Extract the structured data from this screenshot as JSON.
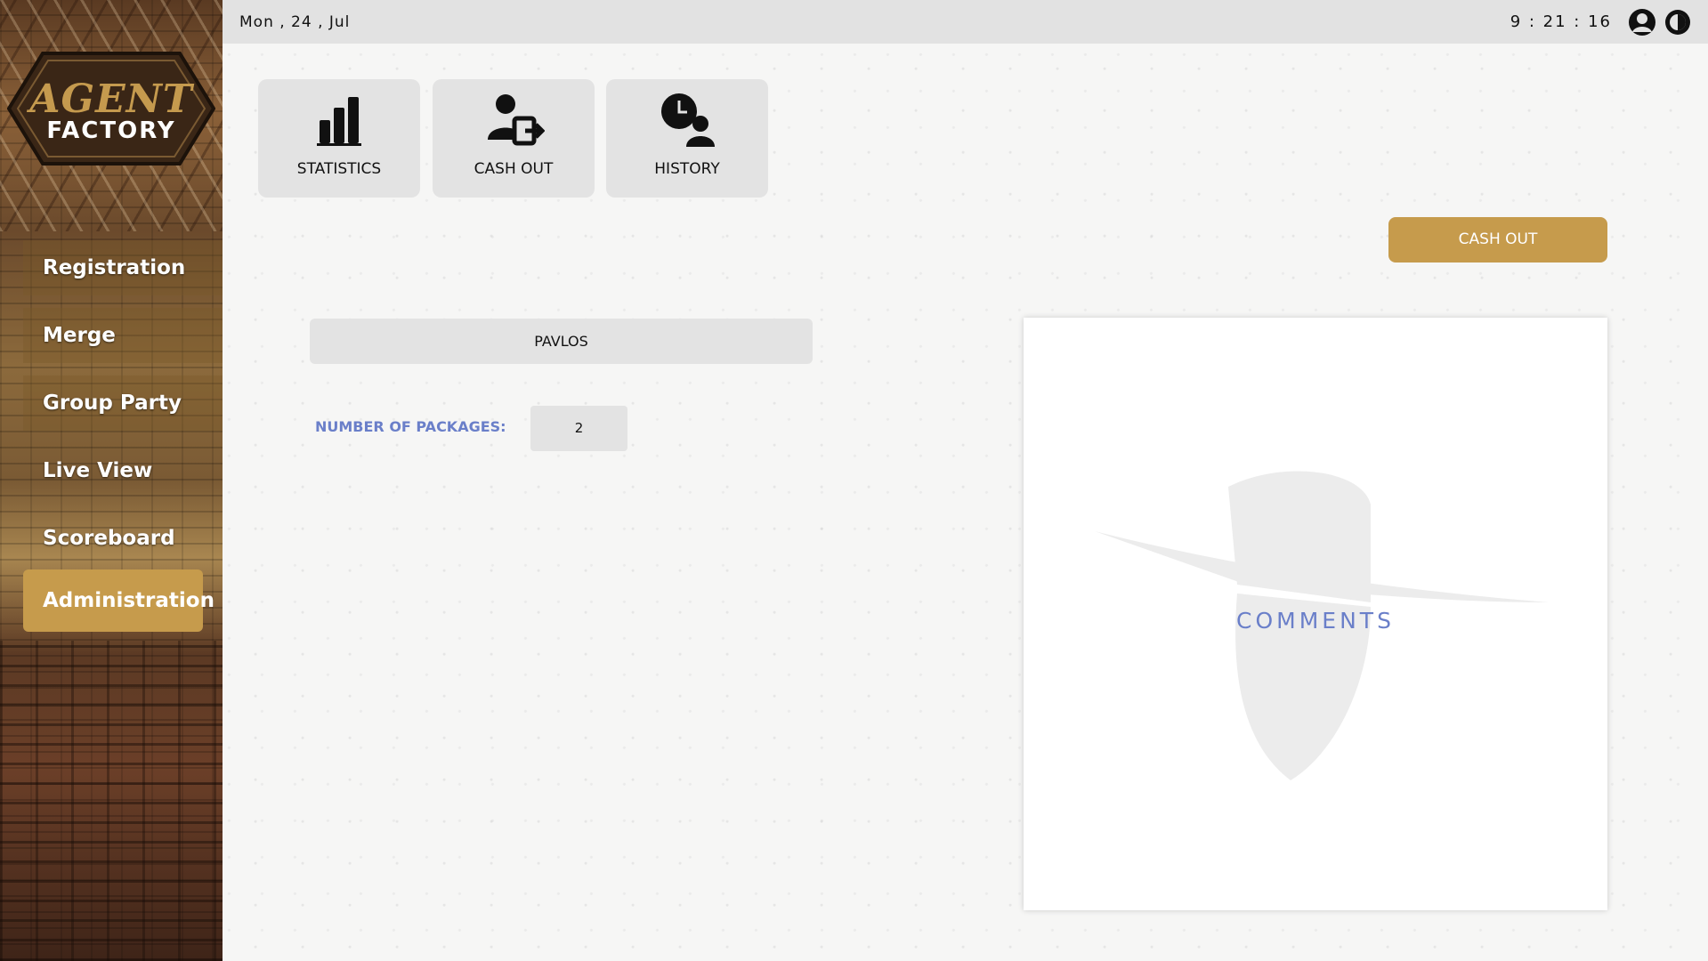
{
  "brand": {
    "logo_line1": "AGENT",
    "logo_line2": "FACTORY"
  },
  "sidebar": {
    "items": [
      {
        "label": "Registration"
      },
      {
        "label": "Merge"
      },
      {
        "label": "Group Party"
      },
      {
        "label": "Live View"
      },
      {
        "label": "Scoreboard"
      },
      {
        "label": "Administration",
        "active": true
      }
    ]
  },
  "topbar": {
    "date": "Mon , 24 , Jul",
    "time": "9 : 21 : 16",
    "icons": [
      "user-icon",
      "contrast-icon"
    ]
  },
  "tiles": [
    {
      "label": "STATISTICS",
      "icon": "bar-chart-icon"
    },
    {
      "label": "CASH OUT",
      "icon": "user-exit-icon"
    },
    {
      "label": "HISTORY",
      "icon": "clock-user-icon"
    }
  ],
  "actions": {
    "cash_out_label": "CASH OUT"
  },
  "form": {
    "name_value": "PAVLOS",
    "packages_label": "NUMBER  OF PACKAGES:",
    "packages_value": "2"
  },
  "comments": {
    "label": "COMMENTS"
  },
  "colors": {
    "accent": "#c69b4c",
    "label_blue": "#6a7fc9",
    "tile_bg": "#e3e3e3",
    "topbar_bg": "#e2e2e2"
  }
}
